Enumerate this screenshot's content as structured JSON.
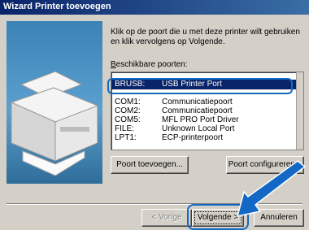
{
  "window": {
    "title": "Wizard Printer toevoegen"
  },
  "instructions": "Klik op de poort die u met deze printer wilt gebruiken en klik vervolgens op Volgende.",
  "ports_label": {
    "accesskey": "B",
    "rest": "eschikbare poorten:"
  },
  "ports": [
    {
      "name": "BRUSB:",
      "description": "USB Printer Port",
      "selected": true
    },
    {
      "name": "COM1:",
      "description": "Communicatiepoort",
      "selected": false
    },
    {
      "name": "COM2:",
      "description": "Communicatiepoort",
      "selected": false
    },
    {
      "name": "COM5:",
      "description": "MFL PRO Port Driver",
      "selected": false
    },
    {
      "name": "FILE:",
      "description": "Unknown Local Port",
      "selected": false
    },
    {
      "name": "LPT1:",
      "description": "ECP-printerpoort",
      "selected": false
    }
  ],
  "buttons": {
    "add_port": "Poort toevoegen...",
    "configure_port": "Poort configureren...",
    "back": "< Vorige",
    "next": "Volgende >",
    "cancel": "Annuleren"
  },
  "colors": {
    "highlight": "#1268c4",
    "selection": "#0a246a"
  }
}
